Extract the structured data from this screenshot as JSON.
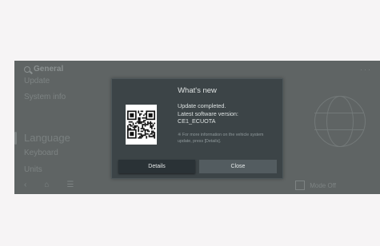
{
  "background": {
    "header": "General",
    "menu_items": [
      "Update",
      "System info"
    ],
    "menu_items_large": [
      "Language"
    ],
    "menu_items_lower": [
      "Keyboard",
      "Units"
    ],
    "right_footer": "Mode Off",
    "nav_glyphs": [
      "‹",
      "⌂",
      "☰"
    ],
    "top_right_glyph": "···"
  },
  "dialog": {
    "title": "What's new",
    "message_lines": [
      "Update completed.",
      "Latest software version:",
      "CE1_ECUOTA"
    ],
    "note": "※ For more information on the vehicle system update, press [Details].",
    "details_label": "Details",
    "close_label": "Close"
  },
  "colors": {
    "screen_bg": "#5f6464",
    "dialog_bg": "#3c4447",
    "details_bg": "#2a3236",
    "close_bg": "#535c60"
  }
}
